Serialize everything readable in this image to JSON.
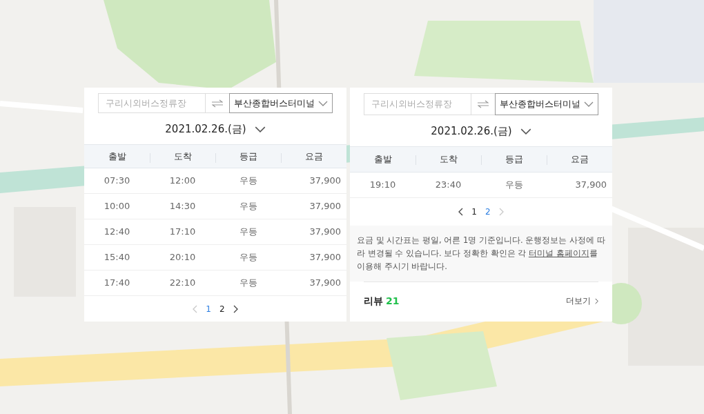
{
  "panels": [
    {
      "route": {
        "from_placeholder": "구리시외버스정류장",
        "to": "부산종합버스터미널"
      },
      "date": "2021.02.26.(금)",
      "columns": [
        "출발",
        "도착",
        "등급",
        "요금"
      ],
      "rows": [
        [
          "07:30",
          "12:00",
          "우등",
          "37,900"
        ],
        [
          "10:00",
          "14:30",
          "우등",
          "37,900"
        ],
        [
          "12:40",
          "17:10",
          "우등",
          "37,900"
        ],
        [
          "15:40",
          "20:10",
          "우등",
          "37,900"
        ],
        [
          "17:40",
          "22:10",
          "우등",
          "37,900"
        ]
      ],
      "pagination": {
        "prev_disabled": true,
        "next_disabled": false,
        "pages": [
          {
            "label": "1",
            "selected": true
          },
          {
            "label": "2",
            "selected": false
          }
        ]
      }
    },
    {
      "route": {
        "from_placeholder": "구리시외버스정류장",
        "to": "부산종합버스터미널"
      },
      "date": "2021.02.26.(금)",
      "columns": [
        "출발",
        "도착",
        "등급",
        "요금"
      ],
      "rows": [
        [
          "19:10",
          "23:40",
          "우등",
          "37,900"
        ]
      ],
      "pagination": {
        "prev_disabled": false,
        "next_disabled": true,
        "pages": [
          {
            "label": "1",
            "selected": false
          },
          {
            "label": "2",
            "selected": true
          }
        ]
      },
      "notice": {
        "before": "요금 및 시간표는 평일, 어른 1명 기준입니다. 운행정보는 사정에 따라 변경될 수 있습니다. 보다 정확한 확인은 각 ",
        "link": "터미널 홈페이지",
        "after": "를 이용해 주시기 바랍니다."
      },
      "review": {
        "label": "리뷰",
        "count": "21",
        "more": "더보기"
      }
    }
  ]
}
